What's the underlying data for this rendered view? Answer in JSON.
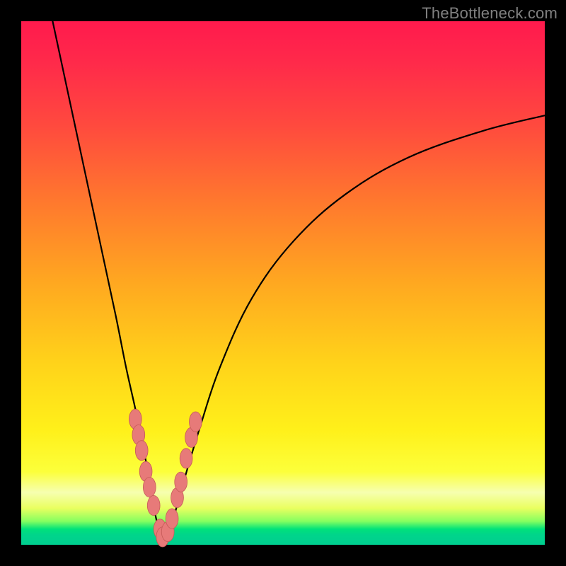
{
  "watermark": "TheBottleneck.com",
  "colors": {
    "frame": "#000000",
    "curve": "#000000",
    "bead_fill": "#e77a79",
    "bead_stroke": "#c55a58",
    "gradient_stops": [
      "#ff1a4d",
      "#ff2a4a",
      "#ff4a3e",
      "#ff7a2d",
      "#ffa820",
      "#ffd21a",
      "#fff01a",
      "#fcff3a",
      "#f6ffb0",
      "#eaff60",
      "#86ff60",
      "#00e27a",
      "#00d58a",
      "#00cf90"
    ]
  },
  "chart_data": {
    "type": "line",
    "title": "",
    "xlabel": "",
    "ylabel": "",
    "xlim": [
      0,
      100
    ],
    "ylim": [
      0,
      100
    ],
    "grid": false,
    "legend": false,
    "notes": "Two branches of a bottleneck curve meeting near x≈27. Left branch falls steeply from top-left; right branch rises with diminishing slope toward top-right. Pink beads cluster along both branches in the lower yellow band (~y 6–24).",
    "series": [
      {
        "name": "left-branch",
        "x": [
          6,
          9,
          12,
          15,
          18,
          20,
          22,
          24,
          25,
          26,
          27
        ],
        "y": [
          100,
          86,
          72,
          58,
          44,
          34,
          25,
          15,
          9,
          4,
          1
        ]
      },
      {
        "name": "right-branch",
        "x": [
          27,
          29,
          31,
          34,
          38,
          44,
          52,
          62,
          74,
          88,
          100
        ],
        "y": [
          1,
          5,
          12,
          22,
          34,
          47,
          58,
          67,
          74,
          79,
          82
        ]
      }
    ],
    "beads_left": [
      {
        "x": 21.8,
        "y": 24.0
      },
      {
        "x": 22.4,
        "y": 21.0
      },
      {
        "x": 23.0,
        "y": 18.0
      },
      {
        "x": 23.8,
        "y": 14.0
      },
      {
        "x": 24.5,
        "y": 11.0
      },
      {
        "x": 25.3,
        "y": 7.5
      },
      {
        "x": 26.5,
        "y": 3.0
      },
      {
        "x": 27.0,
        "y": 1.5
      }
    ],
    "beads_right": [
      {
        "x": 28.0,
        "y": 2.5
      },
      {
        "x": 28.8,
        "y": 5.0
      },
      {
        "x": 29.8,
        "y": 9.0
      },
      {
        "x": 30.5,
        "y": 12.0
      },
      {
        "x": 31.5,
        "y": 16.5
      },
      {
        "x": 32.5,
        "y": 20.5
      },
      {
        "x": 33.3,
        "y": 23.5
      }
    ],
    "bead_rx": 1.2,
    "bead_ry": 1.9
  }
}
